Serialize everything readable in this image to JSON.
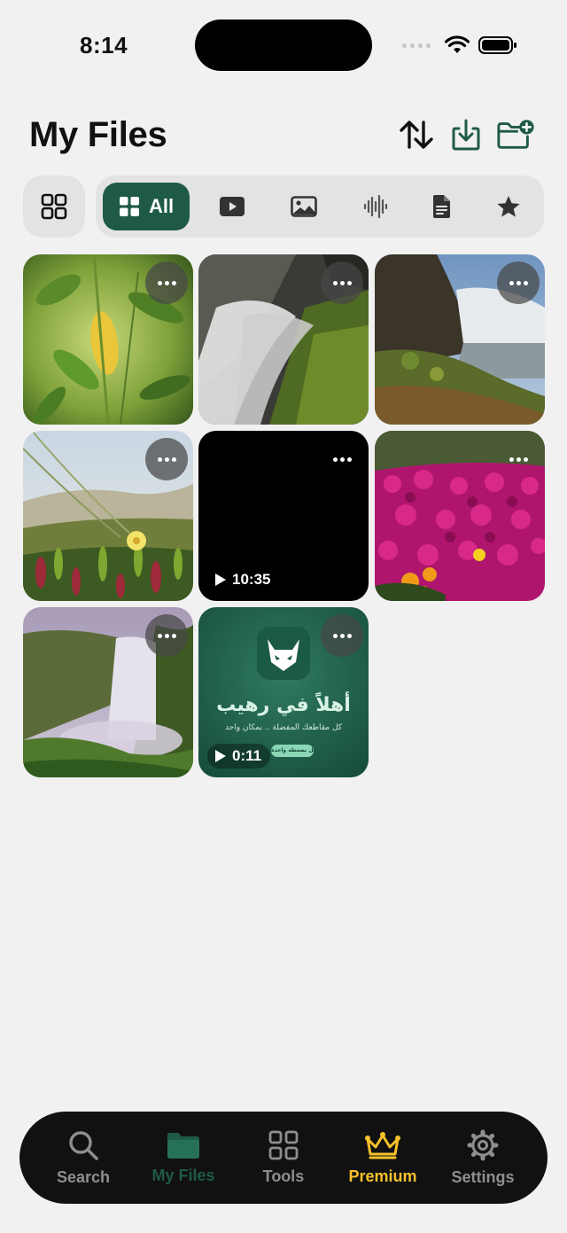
{
  "status": {
    "time": "8:14"
  },
  "header": {
    "title": "My Files"
  },
  "filters": [
    {
      "label": "All",
      "icon": "grid-icon",
      "active": true
    },
    {
      "label": "",
      "icon": "video-icon"
    },
    {
      "label": "",
      "icon": "image-icon"
    },
    {
      "label": "",
      "icon": "audio-icon"
    },
    {
      "label": "",
      "icon": "document-icon"
    },
    {
      "label": "",
      "icon": "star-icon"
    }
  ],
  "files": [
    {
      "type": "image",
      "subject": "green leaves"
    },
    {
      "type": "image",
      "subject": "waterfall closeup"
    },
    {
      "type": "image",
      "subject": "waterfall coast"
    },
    {
      "type": "image",
      "subject": "beach grass flower"
    },
    {
      "type": "video",
      "duration": "10:35"
    },
    {
      "type": "image",
      "subject": "magenta flowers"
    },
    {
      "type": "image",
      "subject": "misty waterfall"
    },
    {
      "type": "video",
      "duration": "0:11",
      "headline": "أهلاً في رهيب",
      "caption": "كل مقاطعك المفضلة .. بمكان واحد",
      "button": "التحميل بضغطة واحدة"
    }
  ],
  "tabbar": {
    "items": [
      {
        "label": "Search",
        "icon": "search-icon"
      },
      {
        "label": "My Files",
        "icon": "folder-icon",
        "active": true
      },
      {
        "label": "Tools",
        "icon": "tools-icon"
      },
      {
        "label": "Premium",
        "icon": "crown-icon"
      },
      {
        "label": "Settings",
        "icon": "gear-icon"
      }
    ]
  },
  "colors": {
    "accent": "#1f5a46",
    "premium": "#f5c12a",
    "inactive_tab": "#8e8e8e",
    "background": "#f1f1f1"
  }
}
